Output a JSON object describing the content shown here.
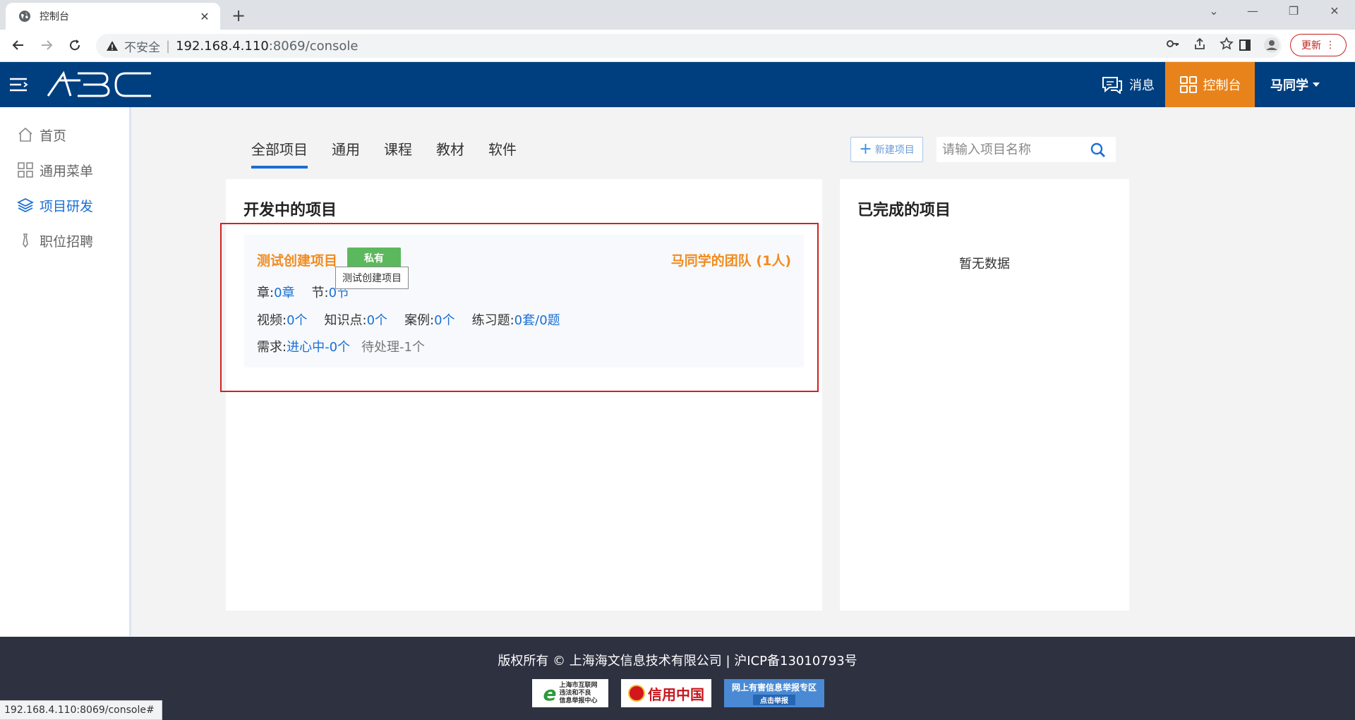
{
  "browser": {
    "tab_title": "控制台",
    "new_tab": "+",
    "insecure_label": "不安全",
    "url_host": "192.168.4.110",
    "url_path": ":8069/console",
    "update_label": "更新"
  },
  "header": {
    "logo_text": "ABC",
    "messages_label": "消息",
    "console_label": "控制台",
    "user_name": "马同学"
  },
  "sidebar": {
    "items": [
      {
        "label": "首页",
        "icon": "home-icon"
      },
      {
        "label": "通用菜单",
        "icon": "grid-icon"
      },
      {
        "label": "项目研发",
        "icon": "layers-icon",
        "active": true
      },
      {
        "label": "职位招聘",
        "icon": "tie-icon"
      }
    ]
  },
  "tabs": [
    "全部项目",
    "通用",
    "课程",
    "教材",
    "软件"
  ],
  "toolbar": {
    "new_project_label": "新建项目",
    "search_placeholder": "请输入项目名称"
  },
  "in_progress": {
    "title": "开发中的项目",
    "project": {
      "name": "测试创建项目",
      "badge": "私有",
      "team": "马同学的团队 (1人)",
      "chapter_label": "章:",
      "chapter_value": "0章",
      "section_label": "节:",
      "section_value": "0节",
      "video_label": "视频:",
      "video_value": "0个",
      "knowledge_label": "知识点:",
      "knowledge_value": "0个",
      "case_label": "案例:",
      "case_value": "0个",
      "exercise_label": "练习题:",
      "exercise_value": "0套/0题",
      "demand_label": "需求:",
      "demand_value": "进心中-0个",
      "pending": "待处理-1个"
    },
    "tooltip": "测试创建项目"
  },
  "completed": {
    "title": "已完成的项目",
    "empty": "暂无数据"
  },
  "footer": {
    "copyright": "版权所有 © 上海海文信息技术有限公司 | 沪ICP备13010793号",
    "badge1_lines": [
      "上海市互联网",
      "违法和不良",
      "信息举报中心"
    ],
    "badge2": "信用中国",
    "badge3_title": "网上有害信息举报专区",
    "badge3_sub": "点击举报"
  },
  "statusbar": "192.168.4.110:8069/console#",
  "colors": {
    "header_bg": "#003f7f",
    "console_bg": "#e8831c",
    "accent_blue": "#1a6fd4",
    "project_orange": "#f28b20",
    "badge_green": "#5cb85c",
    "highlight_red": "#d61f1f"
  }
}
